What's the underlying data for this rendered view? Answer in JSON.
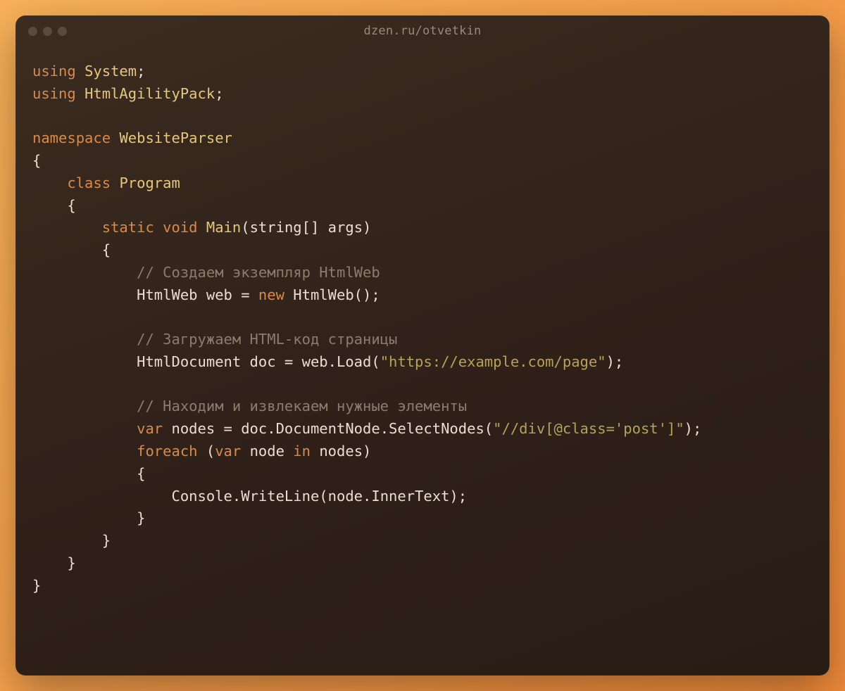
{
  "window": {
    "title": "dzen.ru/otvetkin"
  },
  "code": {
    "kw_using1": "using",
    "id_system": "System",
    "kw_using2": "using",
    "id_hap": "HtmlAgilityPack",
    "kw_namespace": "namespace",
    "id_ns": "WebsiteParser",
    "brace_open1": "{",
    "kw_class": "class",
    "id_program": "Program",
    "brace_open2": "{",
    "kw_static": "static",
    "kw_void": "void",
    "id_main": "Main",
    "sig_open": "(",
    "id_stringarr": "string[] args",
    "sig_close": ")",
    "brace_open3": "{",
    "cm1": "// Создаем экземпляр HtmlWeb",
    "stmt1a": "HtmlWeb web = ",
    "kw_new1": "new",
    "stmt1b": " HtmlWeb();",
    "cm2": "// Загружаем HTML-код страницы",
    "stmt2a": "HtmlDocument doc = web.Load(",
    "str1": "\"https://example.com/page\"",
    "stmt2b": ");",
    "cm3": "// Находим и извлекаем нужные элементы",
    "kw_var": "var",
    "stmt3a": " nodes = doc.DocumentNode.SelectNodes(",
    "str2": "\"//div[@class='post']\"",
    "stmt3b": ");",
    "kw_foreach": "foreach",
    "stmt4a": " (",
    "kw_var2": "var",
    "stmt4b": " node ",
    "kw_in": "in",
    "stmt4c": " nodes)",
    "brace_open4": "{",
    "stmt5": "Console.WriteLine(node.InnerText);",
    "brace_close4": "}",
    "brace_close3": "}",
    "brace_close2": "}",
    "brace_close1": "}"
  }
}
